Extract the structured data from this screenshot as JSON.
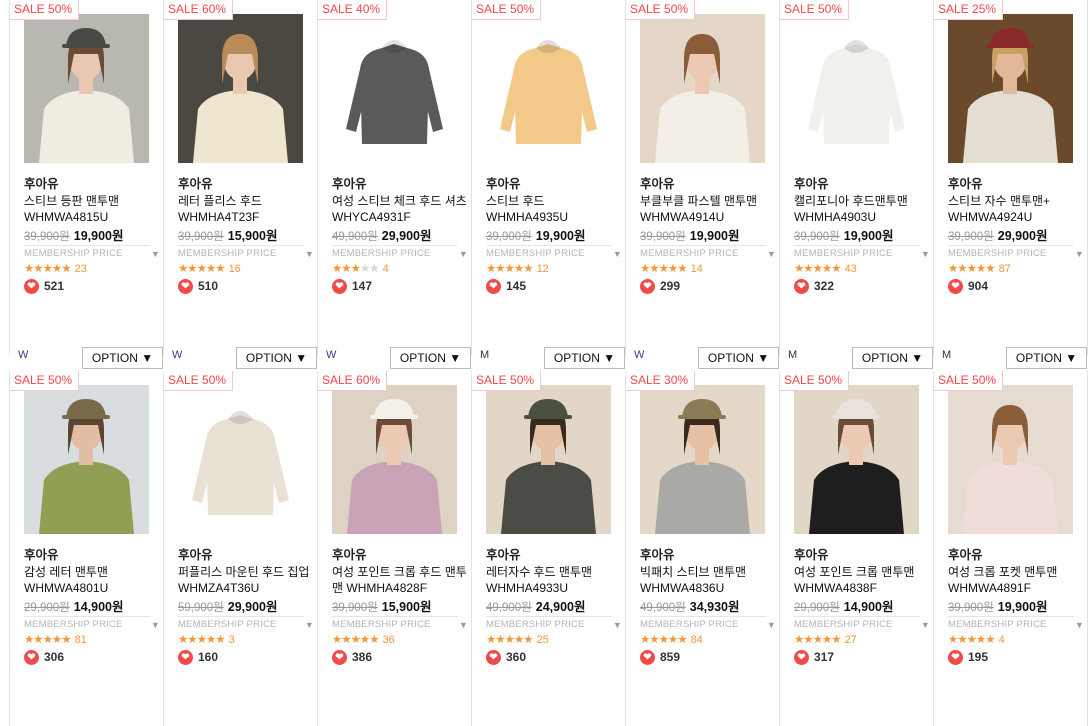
{
  "row1": [
    {
      "sale": "SALE 50%",
      "brand": "후아유",
      "name": "스티브 등판 맨투맨 WHMWA4815U",
      "orig": "39,900원",
      "price": "19,900원",
      "membership": "MEMBERSHIP PRICE",
      "stars": 4.5,
      "reviews": "23",
      "likes": "521",
      "gender": "W",
      "option": "OPTION ▼",
      "img": {
        "bg": "#b8b8b0",
        "garment": "#f1ece2",
        "skin": "#e9c7b0",
        "hair": "#6b4a36",
        "hat": "#4a4a45"
      }
    },
    {
      "sale": "SALE 60%",
      "brand": "후아유",
      "name": "레터 플리스 후드 WHMHA4T23F",
      "orig": "39,900원",
      "price": "15,900원",
      "membership": "MEMBERSHIP PRICE",
      "stars": 4.5,
      "reviews": "16",
      "likes": "510",
      "gender": "W",
      "option": "OPTION ▼",
      "img": {
        "bg": "#4b4741",
        "garment": "#efe6cf",
        "skin": "#e9c7b0",
        "hair": "#b98a5a",
        "hat": ""
      }
    },
    {
      "sale": "SALE 40%",
      "brand": "후아유",
      "name": "여성 스티브 체크 후드 셔츠 WHYCA4931F",
      "orig": "49,900원",
      "price": "29,900원",
      "membership": "MEMBERSHIP PRICE",
      "stars": 3.0,
      "reviews": "4",
      "likes": "147",
      "gender": "W",
      "option": "OPTION ▼",
      "img": {
        "bg": "#ffffff",
        "garment": "#5a5a5a",
        "skin": "",
        "hair": "",
        "hat": ""
      }
    },
    {
      "sale": "SALE 50%",
      "brand": "후아유",
      "name": "스티브 후드 WHMHA4935U",
      "orig": "39,900원",
      "price": "19,900원",
      "membership": "MEMBERSHIP PRICE",
      "stars": 5.0,
      "reviews": "12",
      "likes": "145",
      "gender": "M",
      "option": "OPTION ▼",
      "img": {
        "bg": "#ffffff",
        "garment": "#f3c98a",
        "skin": "",
        "hair": "",
        "hat": ""
      }
    },
    {
      "sale": "SALE 50%",
      "brand": "후아유",
      "name": "부클부클 파스텔 맨투맨 WHMWA4914U",
      "orig": "39,900원",
      "price": "19,900원",
      "membership": "MEMBERSHIP PRICE",
      "stars": 5.0,
      "reviews": "14",
      "likes": "299",
      "gender": "W",
      "option": "OPTION ▼",
      "img": {
        "bg": "#e4d7c8",
        "garment": "#f3eee6",
        "skin": "#ecc9b2",
        "hair": "#8a5c3a",
        "hat": ""
      }
    },
    {
      "sale": "SALE 50%",
      "brand": "후아유",
      "name": "캘리포니아 후드맨투맨 WHMHA4903U",
      "orig": "39,900원",
      "price": "19,900원",
      "membership": "MEMBERSHIP PRICE",
      "stars": 4.5,
      "reviews": "43",
      "likes": "322",
      "gender": "M",
      "option": "OPTION ▼",
      "img": {
        "bg": "#ffffff",
        "garment": "#f2f0ec",
        "skin": "",
        "hair": "",
        "hat": ""
      }
    },
    {
      "sale": "SALE 25%",
      "brand": "후아유",
      "name": "스티브 자수 맨투맨+ WHMWA4924U",
      "orig": "39,900원",
      "price": "29,900원",
      "membership": "MEMBERSHIP PRICE",
      "stars": 5.0,
      "reviews": "87",
      "likes": "904",
      "gender": "M",
      "option": "OPTION ▼",
      "img": {
        "bg": "#6b4a2c",
        "garment": "#e3ddd2",
        "skin": "#e2b89a",
        "hair": "#c9a064",
        "hat": "#8a2a2a"
      }
    }
  ],
  "row2": [
    {
      "sale": "SALE 50%",
      "brand": "후아유",
      "name": "감성 레터 맨투맨 WHMWA4801U",
      "orig": "29,900원",
      "price": "14,900원",
      "membership": "MEMBERSHIP PRICE",
      "stars": 5.0,
      "reviews": "81",
      "likes": "306",
      "img": {
        "bg": "#d8dde0",
        "garment": "#8fa055",
        "skin": "#e2bda3",
        "hair": "#5a4630",
        "hat": "#7a6a4c"
      }
    },
    {
      "sale": "SALE 50%",
      "brand": "후아유",
      "name": "퍼플리스 마운틴 후드 집업 WHMZA4T36U",
      "orig": "59,900원",
      "price": "29,900원",
      "membership": "MEMBERSHIP PRICE",
      "stars": 5.0,
      "reviews": "3",
      "likes": "160",
      "img": {
        "bg": "#ffffff",
        "garment": "#e8e1d4",
        "skin": "",
        "hair": "",
        "hat": ""
      }
    },
    {
      "sale": "SALE 60%",
      "brand": "후아유",
      "name": "여성 포인트 크롭 후드 맨투맨 WHMHA4828F",
      "orig": "39,900원",
      "price": "15,900원",
      "membership": "MEMBERSHIP PRICE",
      "stars": 4.5,
      "reviews": "36",
      "likes": "386",
      "img": {
        "bg": "#ded2c4",
        "garment": "#c8a3b6",
        "skin": "#ecc9b2",
        "hair": "#6b4a36",
        "hat": "#f4f0ea"
      }
    },
    {
      "sale": "SALE 50%",
      "brand": "후아유",
      "name": "레터자수 후드 맨투맨 WHMHA4933U",
      "orig": "49,900원",
      "price": "24,900원",
      "membership": "MEMBERSHIP PRICE",
      "stars": 5.0,
      "reviews": "25",
      "likes": "360",
      "img": {
        "bg": "#e2d6c6",
        "garment": "#4a4d46",
        "skin": "#e6c1a6",
        "hair": "#3a2a1c",
        "hat": "#4a5040"
      }
    },
    {
      "sale": "SALE 30%",
      "brand": "후아유",
      "name": "빅패치 스티브 맨투맨 WHMWA4836U",
      "orig": "49,900원",
      "price": "34,930원",
      "membership": "MEMBERSHIP PRICE",
      "stars": 5.0,
      "reviews": "84",
      "likes": "859",
      "img": {
        "bg": "#e4d8c8",
        "garment": "#a9aaa6",
        "skin": "#e6c1a6",
        "hair": "#3a2a1c",
        "hat": "#8a7a55"
      }
    },
    {
      "sale": "SALE 50%",
      "brand": "후아유",
      "name": "여성 포인트 크롭 맨투맨 WHMWA4838F",
      "orig": "29,900원",
      "price": "14,900원",
      "membership": "MEMBERSHIP PRICE",
      "stars": 5.0,
      "reviews": "27",
      "likes": "317",
      "img": {
        "bg": "#e2d6c6",
        "garment": "#1e1e1e",
        "skin": "#ecc9b2",
        "hair": "#6b4a36",
        "hat": "#e8e2da"
      }
    },
    {
      "sale": "SALE 50%",
      "brand": "후아유",
      "name": "여성 크롭 포켓 맨투맨 WHMWA4891F",
      "orig": "39,900원",
      "price": "19,900원",
      "membership": "MEMBERSHIP PRICE",
      "stars": 4.5,
      "reviews": "4",
      "likes": "195",
      "img": {
        "bg": "#e6dbd0",
        "garment": "#f0dcd8",
        "skin": "#ecc9b2",
        "hair": "#8a5c3a",
        "hat": ""
      }
    }
  ]
}
